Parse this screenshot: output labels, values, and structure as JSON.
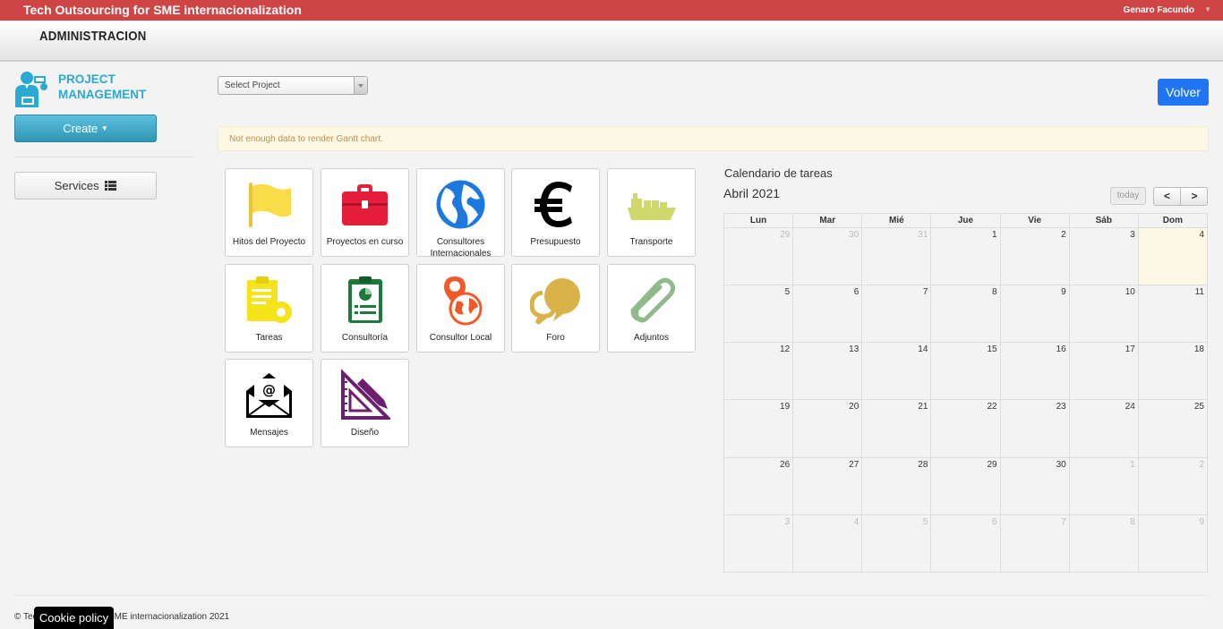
{
  "topbar": {
    "brand": "Tech Outsourcing for SME internacionalization",
    "user": "Genaro Facundo",
    "caret": "▼"
  },
  "admin": {
    "title": "ADMINISTRACION"
  },
  "logo": {
    "line1": "PROJECT",
    "line2": "MANAGEMENT",
    "icon": "project-manager-icon"
  },
  "sidebar": {
    "create_label": "Create",
    "services_label": "Services"
  },
  "project_select": {
    "value": "Select Project"
  },
  "volver_label": "Volver",
  "alert_text": "Not enough data to render Gantt chart.",
  "tiles": [
    {
      "label": "Hitos del Proyecto",
      "icon": "flag-icon",
      "color": "#f8dc4a"
    },
    {
      "label": "Proyectos en curso",
      "icon": "briefcase-icon",
      "color": "#e51e3a"
    },
    {
      "label": "Consultores Internacionales",
      "icon": "globe-icon",
      "color": "#1d78e0"
    },
    {
      "label": "Presupuesto",
      "icon": "euro-icon",
      "color": "#000000"
    },
    {
      "label": "Transporte",
      "icon": "ship-icon",
      "color": "#cfd86a"
    },
    {
      "label": "Tareas",
      "icon": "task-clipboard-icon",
      "color": "#f5e31b"
    },
    {
      "label": "Consultoría",
      "icon": "report-clipboard-icon",
      "color": "#1d7a3a"
    },
    {
      "label": "Consultor Local",
      "icon": "local-map-pin-icon",
      "color": "#f05a2a"
    },
    {
      "label": "Foro",
      "icon": "chat-bubbles-icon",
      "color": "#d9b24a"
    },
    {
      "label": "Adjuntos",
      "icon": "paperclip-icon",
      "color": "#8fba8a"
    },
    {
      "label": "Mensajes",
      "icon": "envelope-icon",
      "color": "#000000"
    },
    {
      "label": "Diseño",
      "icon": "design-ruler-icon",
      "color": "#6b1f6e"
    }
  ],
  "calendar": {
    "title": "Calendario de tareas",
    "month": "Abril 2021",
    "today_label": "today",
    "prev_label": "<",
    "next_label": ">",
    "weekdays": [
      "Lun",
      "Mar",
      "Mié",
      "Jue",
      "Vie",
      "Sáb",
      "Dom"
    ],
    "weeks": [
      [
        {
          "d": "29",
          "other": true
        },
        {
          "d": "30",
          "other": true
        },
        {
          "d": "31",
          "other": true
        },
        {
          "d": "1"
        },
        {
          "d": "2"
        },
        {
          "d": "3"
        },
        {
          "d": "4",
          "today": true
        }
      ],
      [
        {
          "d": "5"
        },
        {
          "d": "6"
        },
        {
          "d": "7"
        },
        {
          "d": "8"
        },
        {
          "d": "9"
        },
        {
          "d": "10"
        },
        {
          "d": "11"
        }
      ],
      [
        {
          "d": "12"
        },
        {
          "d": "13"
        },
        {
          "d": "14"
        },
        {
          "d": "15"
        },
        {
          "d": "16"
        },
        {
          "d": "17"
        },
        {
          "d": "18"
        }
      ],
      [
        {
          "d": "19"
        },
        {
          "d": "20"
        },
        {
          "d": "21"
        },
        {
          "d": "22"
        },
        {
          "d": "23"
        },
        {
          "d": "24"
        },
        {
          "d": "25"
        }
      ],
      [
        {
          "d": "26"
        },
        {
          "d": "27"
        },
        {
          "d": "28"
        },
        {
          "d": "29"
        },
        {
          "d": "30"
        },
        {
          "d": "1",
          "other": true
        },
        {
          "d": "2",
          "other": true
        }
      ],
      [
        {
          "d": "3",
          "other": true
        },
        {
          "d": "4",
          "other": true
        },
        {
          "d": "5",
          "other": true
        },
        {
          "d": "6",
          "other": true
        },
        {
          "d": "7",
          "other": true
        },
        {
          "d": "8",
          "other": true
        },
        {
          "d": "9",
          "other": true
        }
      ]
    ]
  },
  "footer": {
    "text": "© Tech Outsourcing for SME internacionalization 2021",
    "cookie_label": "Cookie policy"
  }
}
